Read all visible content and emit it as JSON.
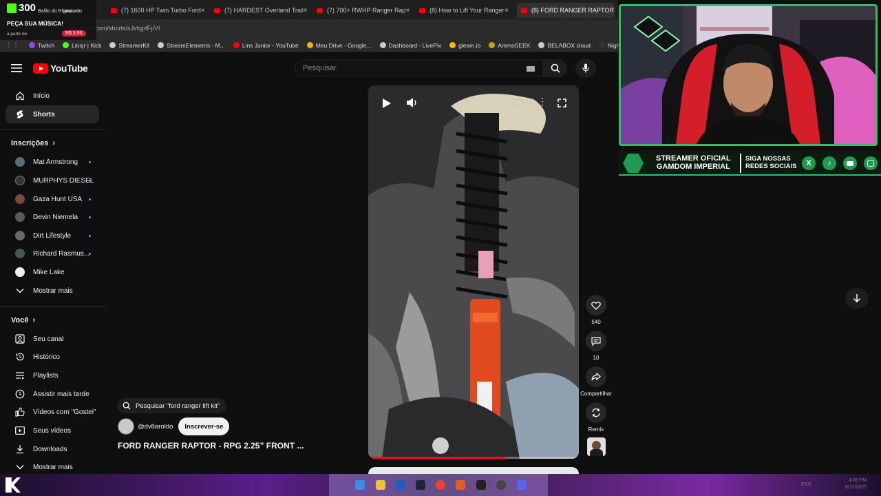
{
  "overlay": {
    "counter": "300",
    "top_line": "Balão do Rhyno",
    "status": "pausado",
    "cta": "PEÇA SUA MÚSICA!",
    "from_label": "a partir de",
    "price": "R$ 3.00"
  },
  "tabs": [
    {
      "label": "(7) 1600 HP Twin Turbo Ford",
      "active": false
    },
    {
      "label": "(7) HARDEST Overland Trail",
      "active": false
    },
    {
      "label": "(7) 700+ RWHP Ranger Rap",
      "active": false
    },
    {
      "label": "(8) How to Lift Your Ranger",
      "active": false
    },
    {
      "label": "(8) FORD RANGER RAPTOR",
      "active": true
    }
  ],
  "url": "youtube.com/shorts/sJvfqptFpVI",
  "bookmarks": [
    {
      "label": "Twitch",
      "color": "#9146ff"
    },
    {
      "label": "Linsjr | Kick",
      "color": "#53fc18"
    },
    {
      "label": "StreamerKit",
      "color": "#cccccc"
    },
    {
      "label": "StreamElements - M...",
      "color": "#cccccc"
    },
    {
      "label": "Lins Junior - YouTube",
      "color": "#ff0000"
    },
    {
      "label": "Meu Drive - Google...",
      "color": "#f4b400"
    },
    {
      "label": "Dashboard - LivePix",
      "color": "#cccccc"
    },
    {
      "label": "gleam.io",
      "color": "#f0c000"
    },
    {
      "label": "AmmoSEEK",
      "color": "#c9a400"
    },
    {
      "label": "BELABOX cloud",
      "color": "#cccccc"
    },
    {
      "label": "Nightbot - Comm",
      "color": "#333333"
    }
  ],
  "header": {
    "logo_text": "YouTube",
    "search_placeholder": "Pesquisar"
  },
  "sidebar": {
    "main": [
      {
        "label": "Início",
        "icon": "home-icon",
        "active": false
      },
      {
        "label": "Shorts",
        "icon": "shorts-icon",
        "active": true
      }
    ],
    "subscriptions_title": "Inscrições",
    "subscriptions": [
      {
        "label": "Mat Armstrong",
        "color": "#5a6a7a",
        "new": true
      },
      {
        "label": "MURPHYS DIESEL",
        "color": "#333333",
        "new": true
      },
      {
        "label": "Gaza Hunt USA",
        "color": "#7a4a3a",
        "new": true
      },
      {
        "label": "Devin Niemela",
        "color": "#5a5a5a",
        "new": true
      },
      {
        "label": "Dirt Lifestyle",
        "color": "#6a6a6a",
        "new": true
      },
      {
        "label": "Richard Rasmus...",
        "color": "#4a5a4a",
        "new": true
      },
      {
        "label": "Mike Lake",
        "color": "#eeeeee",
        "new": false
      }
    ],
    "show_more_1": "Mostrar mais",
    "you_title": "Você",
    "you_items": [
      {
        "label": "Seu canal",
        "icon": "channel-icon"
      },
      {
        "label": "Histórico",
        "icon": "history-icon"
      },
      {
        "label": "Playlists",
        "icon": "playlists-icon"
      },
      {
        "label": "Assistir mais tarde",
        "icon": "watch-later-icon"
      },
      {
        "label": "Vídeos com \"Gostei\"",
        "icon": "liked-icon"
      },
      {
        "label": "Seus vídeos",
        "icon": "your-videos-icon"
      },
      {
        "label": "Downloads",
        "icon": "downloads-icon"
      }
    ],
    "show_more_2": "Mostrar mais"
  },
  "short": {
    "search_suggestion": "Pesquisar \"ford ranger lift kit\"",
    "channel": "@dv8aroldo",
    "subscribe_label": "Inscrever-se",
    "title": "FORD RANGER RAPTOR - RPG 2.25” FRONT ...",
    "progress": 0.65
  },
  "actions": {
    "likes": "540",
    "comments": "10",
    "share": "Compartilhar",
    "remix": "Remix"
  },
  "banner": {
    "left_line1": "STREAMER OFICIAL",
    "left_line2": "GAMDOM IMPERIAL",
    "right_line1": "SIGA NOSSAS",
    "right_line2": "REDES SOCIAIS"
  },
  "tray": {
    "lang": "ENG",
    "time": "4:08 PM",
    "date": "8/12/2025"
  },
  "colors": {
    "youtube_red": "#ff0000",
    "accent_green": "#2fbf6a",
    "new_dot": "#3ea6ff"
  }
}
